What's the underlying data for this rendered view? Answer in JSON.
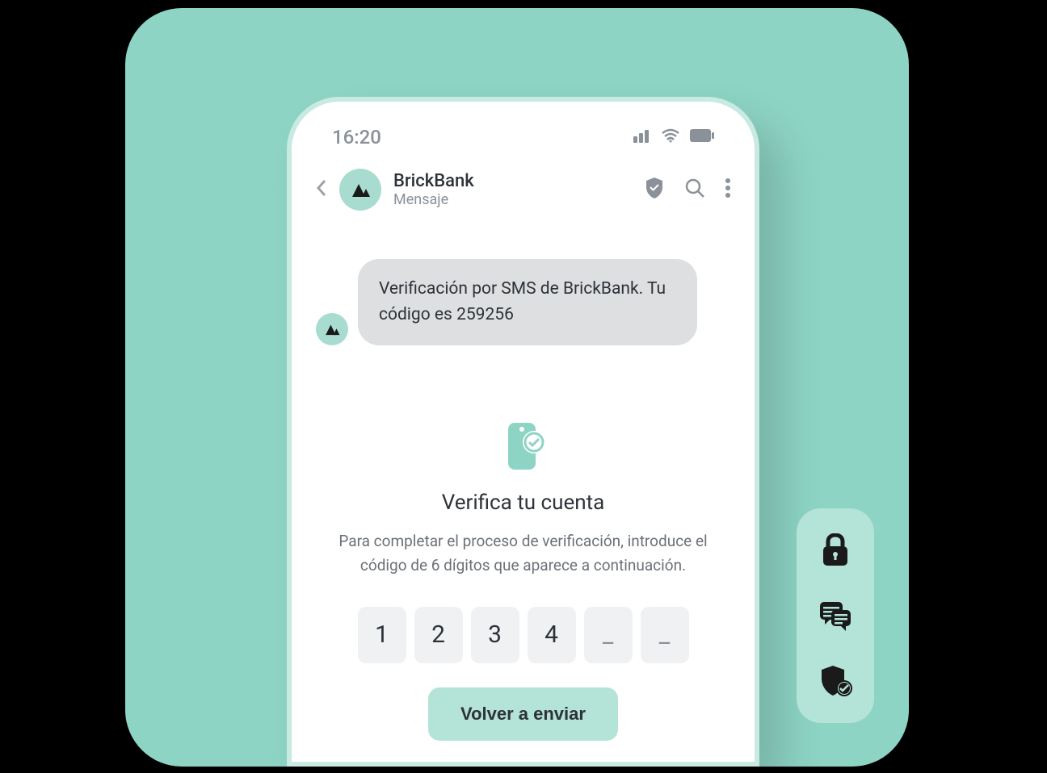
{
  "status": {
    "time": "16:20"
  },
  "header": {
    "sender_name": "BrickBank",
    "sender_sub": "Mensaje"
  },
  "message": {
    "text": "Verificación por SMS de BrickBank. Tu código es 259256"
  },
  "verify": {
    "title": "Verifica tu cuenta",
    "description": "Para completar el proceso de verificación, introduce el código de 6 dígitos que aparece a continuación.",
    "code": [
      "1",
      "2",
      "3",
      "4",
      "_",
      "_"
    ],
    "resend_label": "Volver a enviar"
  }
}
